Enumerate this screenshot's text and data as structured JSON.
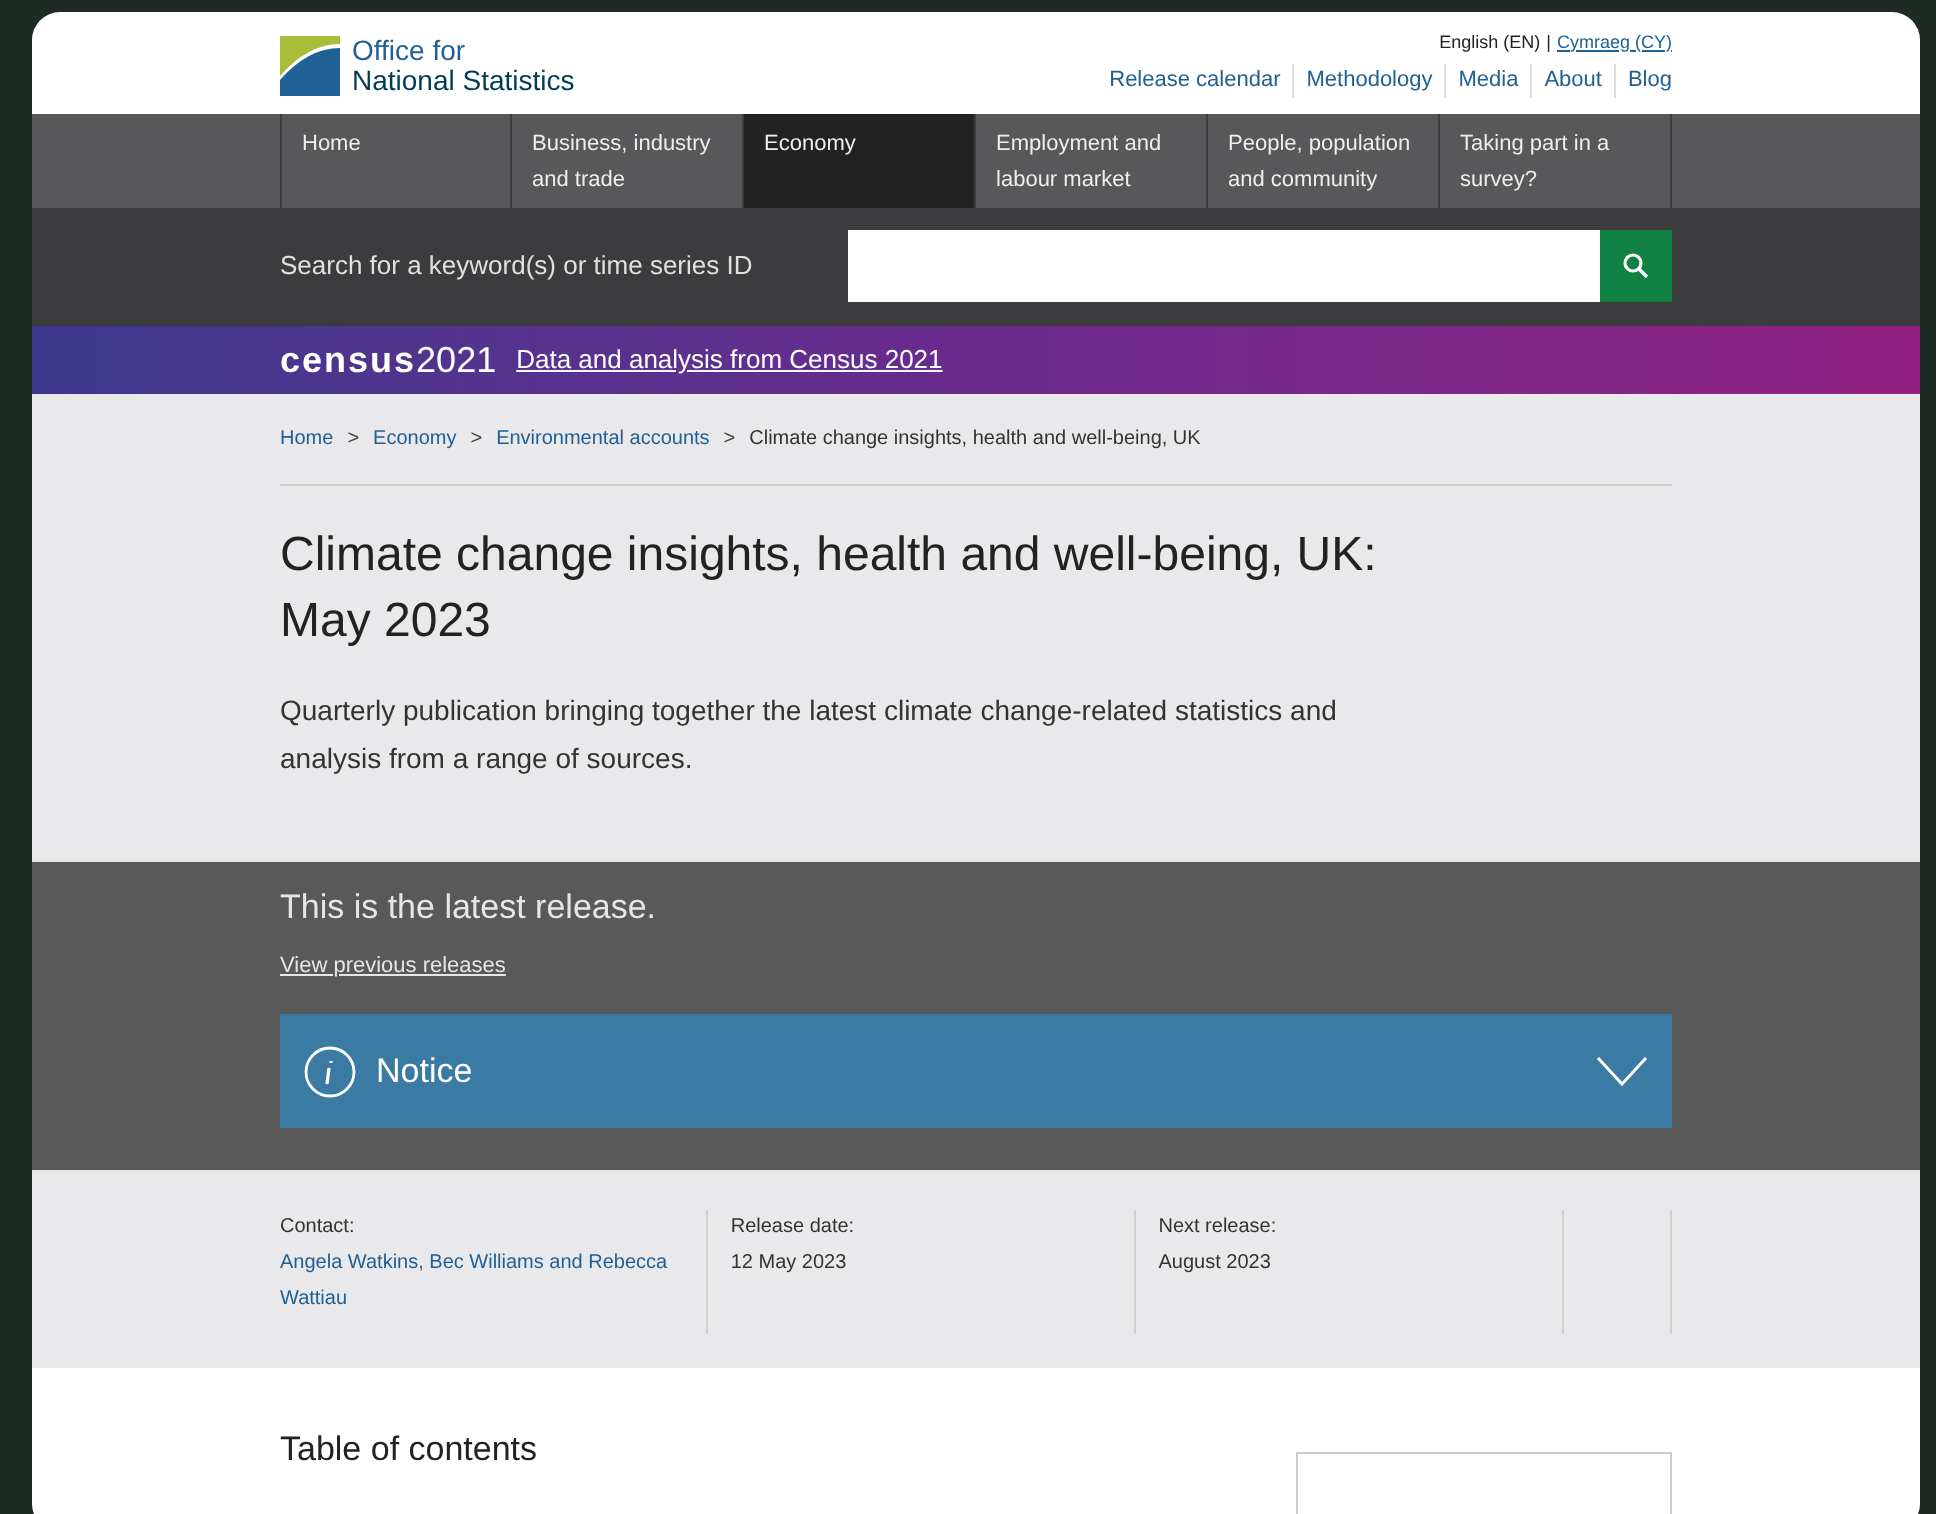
{
  "header": {
    "logo_text": [
      "Office for",
      "National Statistics"
    ],
    "language": {
      "current": "English (EN)",
      "separator": "|",
      "other": "Cymraeg (CY)"
    },
    "links": [
      "Release calendar",
      "Methodology",
      "Media",
      "About",
      "Blog"
    ]
  },
  "nav": [
    {
      "label": "Home",
      "selected": false
    },
    {
      "label": "Business, industry and trade",
      "selected": false
    },
    {
      "label": "Economy",
      "selected": true
    },
    {
      "label": "Employment and labour market",
      "selected": false
    },
    {
      "label": "People, population and community",
      "selected": false
    },
    {
      "label": "Taking part in a survey?",
      "selected": false
    }
  ],
  "search": {
    "label": "Search for a keyword(s) or time series ID"
  },
  "census_banner": {
    "logo_word": "census",
    "logo_year": "2021",
    "link": "Data and analysis from Census 2021"
  },
  "breadcrumb": [
    {
      "label": "Home",
      "kind": "link"
    },
    {
      "label": "Economy",
      "kind": "link"
    },
    {
      "label": "Environmental accounts",
      "kind": "link"
    },
    {
      "label": "Climate change insights, health and well-being, UK",
      "kind": "current"
    }
  ],
  "breadcrumb_separator": ">",
  "title": "Climate change insights, health and well-being, UK: May 2023",
  "summary": "Quarterly publication bringing together the latest climate change-related statistics and analysis from a range of sources.",
  "release_status": {
    "text": "This is the latest release.",
    "link": "View previous releases"
  },
  "notice": {
    "label": "Notice",
    "expanded": false
  },
  "meta": [
    {
      "label": "Contact:",
      "value": "Angela Watkins, Bec Williams and Rebecca Wattiau",
      "kind": "link"
    },
    {
      "label": "Release date:",
      "value": "12 May 2023",
      "kind": "text"
    },
    {
      "label": "Next release:",
      "value": "August 2023",
      "kind": "text"
    }
  ],
  "toc_heading": "Table of contents"
}
